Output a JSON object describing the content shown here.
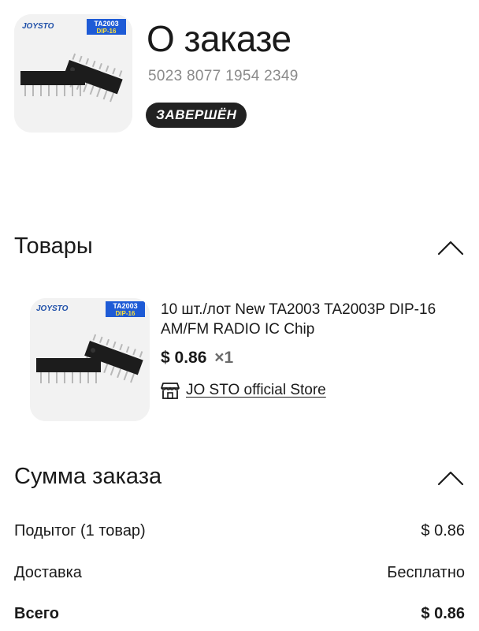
{
  "header": {
    "title": "О заказе",
    "order_number": "5023 8077 1954 2349",
    "status": "ЗАВЕРШЁН"
  },
  "product_image": {
    "brand_mark": "JOYSTO",
    "chip_label_top": "TA2003",
    "chip_label_bottom": "DIP-16"
  },
  "items_section": {
    "title": "Товары",
    "items": [
      {
        "name": "10 шт./лот New TA2003 TA2003P DIP-16 AM/FM RADIO IC Chip",
        "price": "$ 0.86",
        "quantity": "×1",
        "store": "JO STO official Store",
        "store_icon": "store-icon"
      }
    ]
  },
  "summary_section": {
    "title": "Сумма заказа",
    "subtotal_label": "Подытог (1 товар)",
    "subtotal_value": "$ 0.86",
    "shipping_label": "Доставка",
    "shipping_value": "Бесплатно",
    "total_label": "Всего",
    "total_value": "$ 0.86"
  },
  "colors": {
    "badge_bg": "#222222",
    "muted_text": "#8a8a8a",
    "thumb_bg": "#f2f2f2"
  }
}
